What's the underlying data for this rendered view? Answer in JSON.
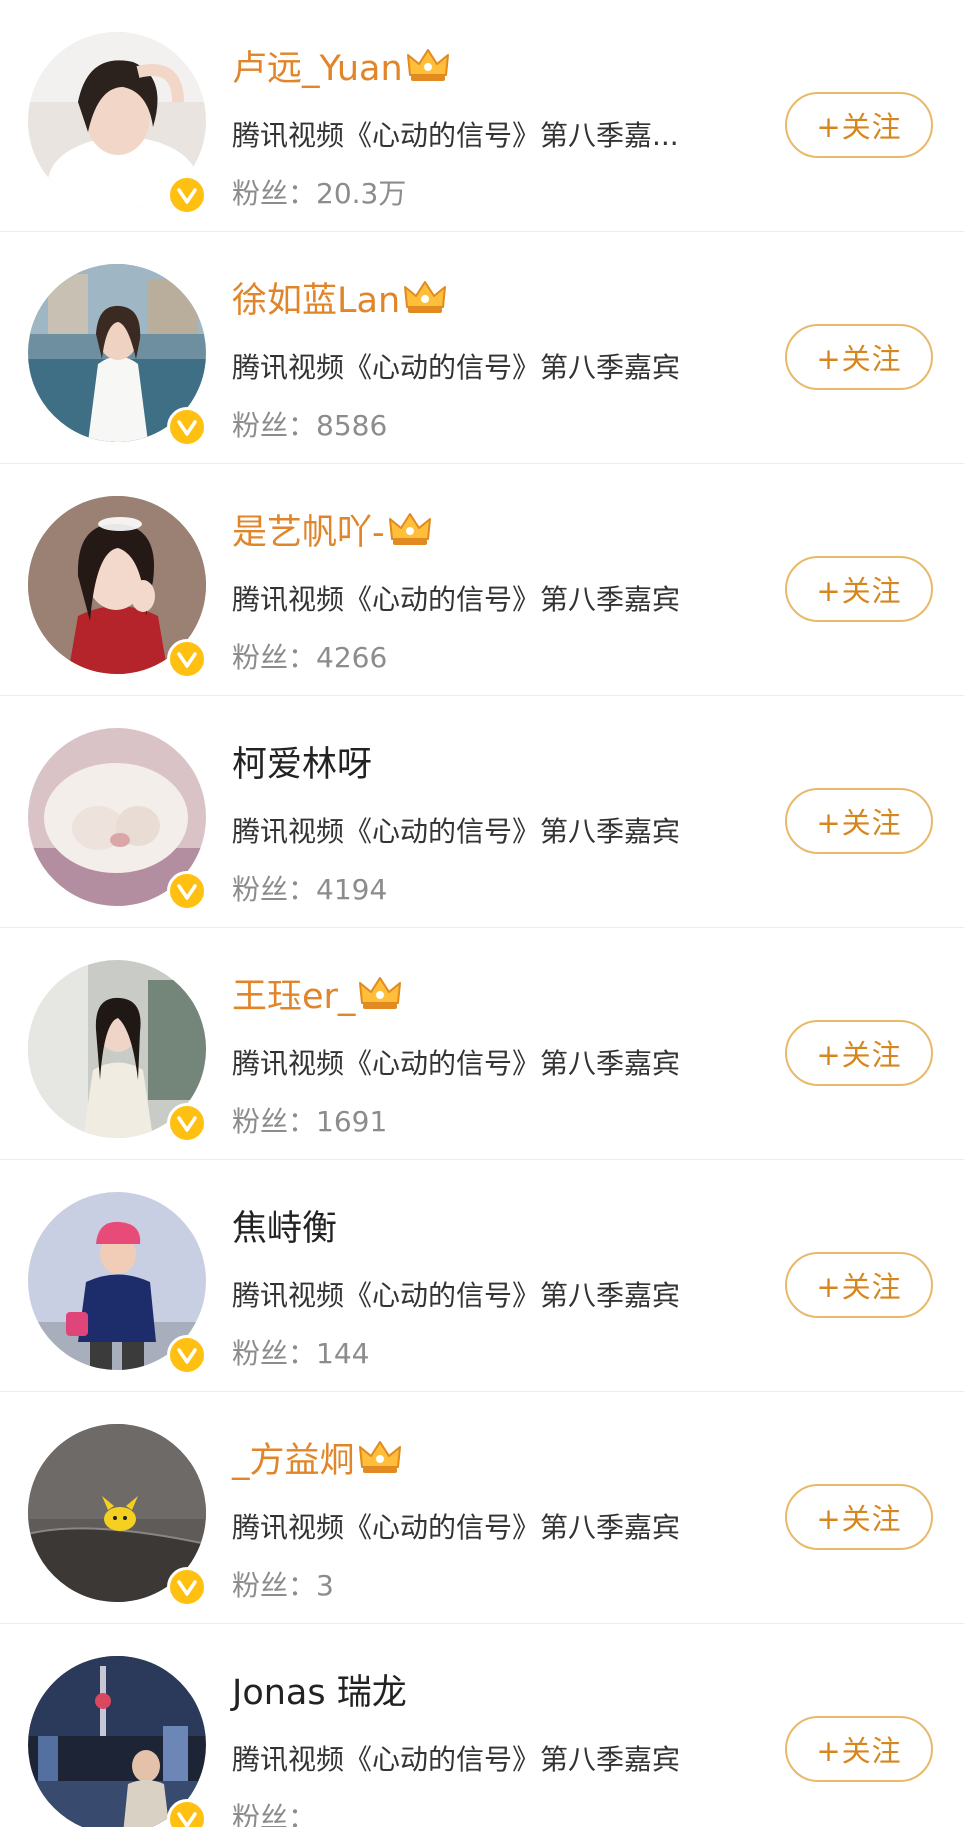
{
  "colors": {
    "vip_name": "#e0852a",
    "follow_text": "#d6861f",
    "follow_border": "#e8b96a",
    "verified_badge": "#ffc012"
  },
  "users": [
    {
      "name": "卢远_Yuan",
      "vip": true,
      "desc": "腾讯视频《心动的信号》第八季嘉...",
      "fans": "粉丝：20.3万",
      "follow": "+关注",
      "avatar_icon": "avatar-photo",
      "badge_icon": "verified-badge-icon"
    },
    {
      "name": "徐如蓝Lan",
      "vip": true,
      "desc": "腾讯视频《心动的信号》第八季嘉宾",
      "fans": "粉丝：8586",
      "follow": "+关注",
      "avatar_icon": "avatar-photo",
      "badge_icon": "verified-badge-icon"
    },
    {
      "name": "是艺帆吖-",
      "vip": true,
      "desc": "腾讯视频《心动的信号》第八季嘉宾",
      "fans": "粉丝：4266",
      "follow": "+关注",
      "avatar_icon": "avatar-photo",
      "badge_icon": "verified-badge-icon"
    },
    {
      "name": "柯爱林呀",
      "vip": false,
      "desc": "腾讯视频《心动的信号》第八季嘉宾",
      "fans": "粉丝：4194",
      "follow": "+关注",
      "avatar_icon": "avatar-photo",
      "badge_icon": "verified-badge-icon"
    },
    {
      "name": "王珏er_",
      "vip": true,
      "desc": "腾讯视频《心动的信号》第八季嘉宾",
      "fans": "粉丝：1691",
      "follow": "+关注",
      "avatar_icon": "avatar-photo",
      "badge_icon": "verified-badge-icon"
    },
    {
      "name": "焦峙衡",
      "vip": false,
      "desc": "腾讯视频《心动的信号》第八季嘉宾",
      "fans": "粉丝：144",
      "follow": "+关注",
      "avatar_icon": "avatar-photo",
      "badge_icon": "verified-badge-icon"
    },
    {
      "name": "_方益炯",
      "vip": true,
      "desc": "腾讯视频《心动的信号》第八季嘉宾",
      "fans": "粉丝：3",
      "follow": "+关注",
      "avatar_icon": "avatar-photo",
      "badge_icon": "verified-badge-icon"
    },
    {
      "name": "Jonas 瑞龙",
      "vip": false,
      "desc": "腾讯视频《心动的信号》第八季嘉宾",
      "fans": "粉丝：",
      "follow": "+关注",
      "avatar_icon": "avatar-photo",
      "badge_icon": "verified-badge-icon"
    }
  ]
}
